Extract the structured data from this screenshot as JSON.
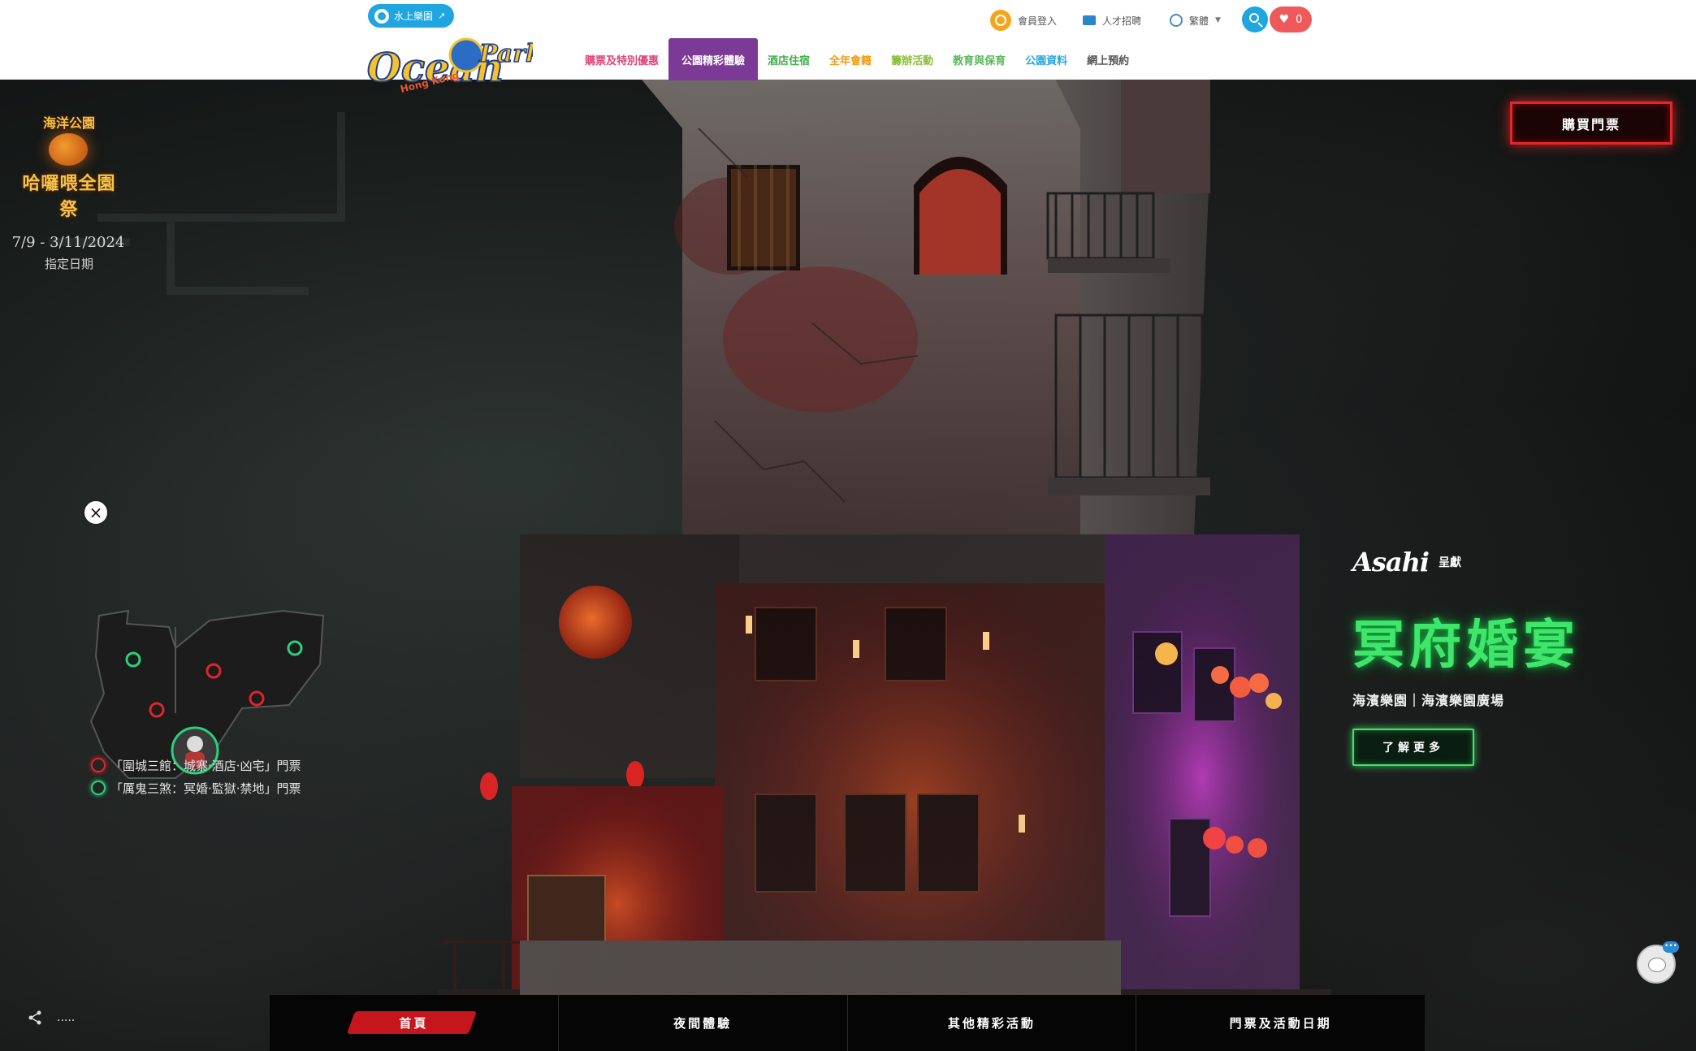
{
  "header": {
    "water_park_label": "水上樂園",
    "water_park_ext": "↗",
    "logo_alt": "Ocean Park Hong Kong",
    "member_login": "會員登入",
    "careers": "人才招聘",
    "language": "繁體",
    "favorites_count": "0",
    "nav": [
      {
        "label": "購票及特別優惠",
        "color": "#e0457b"
      },
      {
        "label": "公園精彩體驗",
        "color": "#ffffff",
        "active": true
      },
      {
        "label": "酒店住宿",
        "color": "#3fae49"
      },
      {
        "label": "全年會籍",
        "color": "#f39c12"
      },
      {
        "label": "籌辦活動",
        "color": "#8bbf3a"
      },
      {
        "label": "教育與保育",
        "color": "#5cb85c"
      },
      {
        "label": "公園資料",
        "color": "#29a8e0"
      },
      {
        "label": "網上預約",
        "color": "#555555"
      }
    ]
  },
  "hero": {
    "festival": {
      "brand": "海洋公園",
      "name": "哈囉喂全園祭",
      "dates": "7/9 - 3/11/2024",
      "note": "指定日期"
    },
    "buy_ticket": "購買門票",
    "legend": [
      {
        "label": "「圍城三館：城寨‧酒店‧凶宅」門票",
        "color": "#e0242a"
      },
      {
        "label": "「厲鬼三煞：冥婚‧監獄‧禁地」門票",
        "color": "#2ad07a"
      }
    ],
    "promo": {
      "sponsor": "Asahi",
      "presents": "呈獻",
      "title": "冥府婚宴",
      "venue": "海濱樂園｜海濱樂園廣場",
      "more": "了解更多"
    },
    "tabs": [
      {
        "label": "首頁",
        "active": true
      },
      {
        "label": "夜間體驗"
      },
      {
        "label": "其他精彩活動"
      },
      {
        "label": "門票及活動日期"
      }
    ],
    "share_dots": "....."
  },
  "colors": {
    "nav_active_bg": "#7b3a95",
    "buy_glow": "#e8242a",
    "promo_glow": "#3ee66a",
    "brand_blue": "#1fa5e0"
  }
}
